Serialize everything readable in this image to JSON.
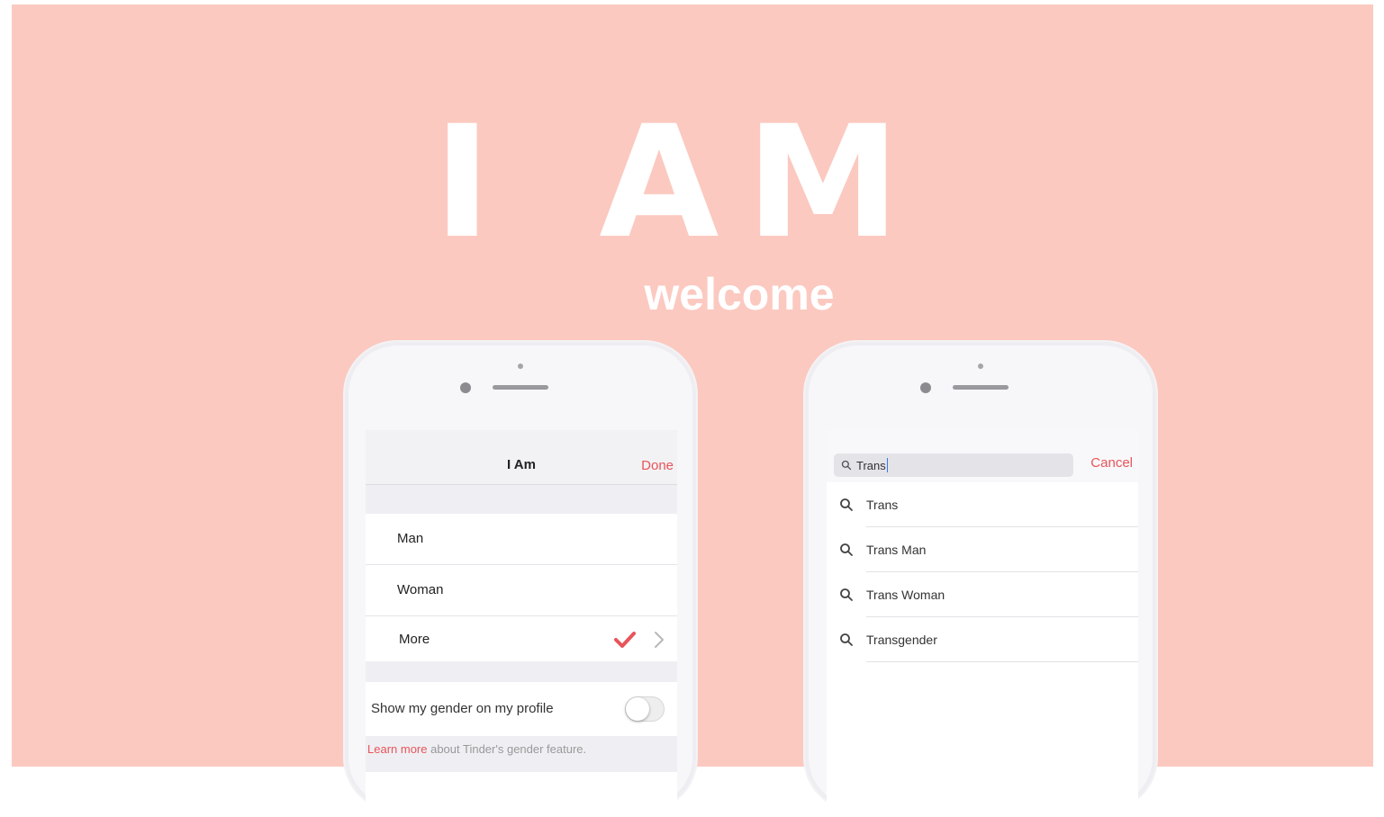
{
  "hero": {
    "title": "I AM",
    "subtitle": "welcome"
  },
  "left_phone": {
    "nav": {
      "title": "I Am",
      "done_label": "Done"
    },
    "options": [
      {
        "label": "Man"
      },
      {
        "label": "Woman"
      },
      {
        "label": "More",
        "selected": true
      }
    ],
    "toggle": {
      "label": "Show my gender on my profile",
      "on": false
    },
    "footer": {
      "link_text": "Learn more",
      "rest_text": " about Tinder's gender feature."
    }
  },
  "right_phone": {
    "search": {
      "query": "Trans",
      "cancel_label": "Cancel"
    },
    "suggestions": [
      {
        "label": "Trans"
      },
      {
        "label": "Trans Man"
      },
      {
        "label": "Trans Woman"
      },
      {
        "label": "Transgender"
      }
    ]
  },
  "colors": {
    "background": "#fbc9c0",
    "accent": "#e8545a"
  },
  "icons": [
    "search-icon",
    "checkmark-icon",
    "chevron-right-icon"
  ]
}
